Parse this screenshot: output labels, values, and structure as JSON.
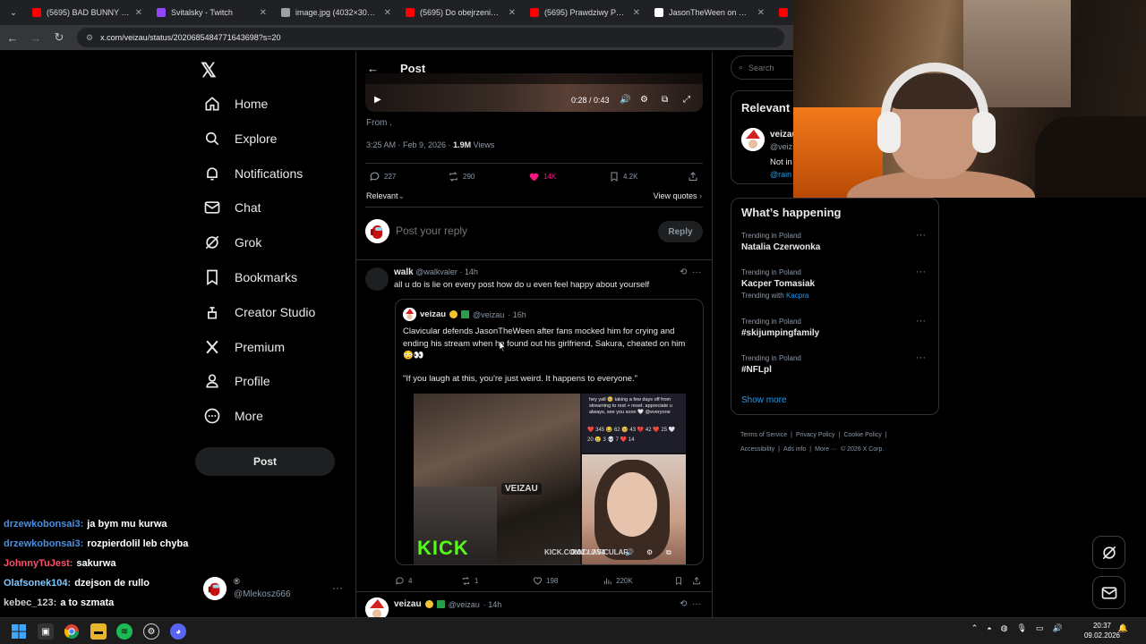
{
  "browser": {
    "tabs": [
      {
        "title": "(5695) BAD BUNNY x DRA",
        "color": "#ff0000"
      },
      {
        "title": "Svitalsky - Twitch",
        "color": "#9146ff"
      },
      {
        "title": "image.jpg (4032×3024)",
        "color": "#9aa0a6"
      },
      {
        "title": "(5695) Do obejrzenia - Yo",
        "color": "#ff0000"
      },
      {
        "title": "(5695) Prawdziwy Powód",
        "color": "#ff0000"
      },
      {
        "title": "JasonTheWeen on X: \"http",
        "color": "#ffffff"
      },
      {
        "title": "(5",
        "color": "#ff0000"
      }
    ],
    "url": "x.com/veizau/status/2020685484771643698?s=20"
  },
  "nav": {
    "items": [
      {
        "label": "Home",
        "icon": "home-icon"
      },
      {
        "label": "Explore",
        "icon": "search-icon"
      },
      {
        "label": "Notifications",
        "icon": "bell-icon"
      },
      {
        "label": "Chat",
        "icon": "mail-icon"
      },
      {
        "label": "Grok",
        "icon": "grok-icon"
      },
      {
        "label": "Bookmarks",
        "icon": "bookmark-icon"
      },
      {
        "label": "Creator Studio",
        "icon": "creator-icon"
      },
      {
        "label": "Premium",
        "icon": "x-logo-icon"
      },
      {
        "label": "Profile",
        "icon": "person-icon"
      },
      {
        "label": "More",
        "icon": "more-circle-icon"
      }
    ],
    "post_button": "Post"
  },
  "main": {
    "header_title": "Post",
    "video_time": "0:28 / 0:43",
    "from_text": "From .",
    "timestamp": "3:25 AM · Feb 9, 2026 · ",
    "views_count": "1.9M",
    "views_label": " Views",
    "actions": {
      "replies": "227",
      "reposts": "290",
      "likes": "14K",
      "bookmarks": "4.2K"
    },
    "sort_label": "Relevant",
    "view_quotes": "View quotes",
    "reply_placeholder": "Post your reply",
    "reply_button": "Reply"
  },
  "reply_tweet": {
    "name": "walk",
    "handle": "@walkvaler",
    "time": "· 14h",
    "text": "all u do is lie on every post how do u even feel happy about yourself",
    "quote": {
      "name": "veizau",
      "handle": "@veizau",
      "time": "· 16h",
      "text": "Clavicular defends JasonTheWeen after fans mocked him for crying and ending his stream when he found out his girlfriend, Sakura, cheated on him 😳👀",
      "quote_text": "\"If you laugh at this, you're just weird. It happens to everyone.\"",
      "media_tag": "VEIZAU",
      "media_brand": "KICK",
      "media_url": "KICK.COM/CLAVICULAR",
      "media_time": "0:02 / 0:54",
      "screen_text": "hey yall 🥺 taking a few days off from streaming to rest + reset. appreciate u always, see you soon 🤍 @everyone",
      "screen_stats": "❤️ 345 😂 62 🥺 43 💔 42 ❤️ 25 🤍 20 😢 3 💀 7 ❤️ 14"
    },
    "actions": {
      "replies": "4",
      "reposts": "1",
      "likes": "198",
      "views": "220K"
    }
  },
  "next_tweet": {
    "name": "veizau",
    "handle": "@veizau",
    "time": "· 14h"
  },
  "right": {
    "search_placeholder": "Search",
    "relevant_title": "Relevant",
    "relevant_name": "veizau",
    "relevant_handle": "@veiz",
    "relevant_bio": "Not in",
    "relevant_link": "@rain",
    "happening_title": "What’s happening",
    "trends": [
      {
        "context": "Trending in Poland",
        "name": "Natalia Czerwonka",
        "with": "",
        "with_link": ""
      },
      {
        "context": "Trending in Poland",
        "name": "Kacper Tomasiak",
        "with": "Trending with ",
        "with_link": "Kacpra"
      },
      {
        "context": "Trending in Poland",
        "name": "#skijumpingfamily",
        "with": "",
        "with_link": ""
      },
      {
        "context": "Trending in Poland",
        "name": "#NFLpl",
        "with": "",
        "with_link": ""
      }
    ],
    "show_more": "Show more",
    "footer": [
      "Terms of Service",
      "|",
      "Privacy Policy",
      "|",
      "Cookie Policy",
      "|",
      "Accessibility",
      "|",
      "Ads info",
      "|",
      "More ···",
      "© 2026 X Corp."
    ]
  },
  "chat": {
    "lines": [
      {
        "user": "drzewkobonsai3:",
        "msg": "ja bym mu kurwa",
        "color": "#4a90e2"
      },
      {
        "user": "drzewkobonsai3:",
        "msg": "rozpierdolil leb chyba",
        "color": "#4a90e2"
      },
      {
        "user": "JohnnyTuJest:",
        "msg": "sakurwa",
        "color": "#ff4f6d"
      },
      {
        "user": "Olafsonek104:",
        "msg": "dzejson de rullo",
        "color": "#7fc8ff"
      },
      {
        "user": "kebec_123:",
        "msg": "a to szmata",
        "color": "#cfcfcf"
      }
    ]
  },
  "account_switcher": {
    "label": "®",
    "handle": "@Mlekosz666"
  },
  "taskbar": {
    "time": "20:37",
    "date": "09.02.2026"
  },
  "colors": {
    "accent": "#1d9bf0",
    "like": "#f91880",
    "background": "#000000",
    "border": "#2f3336"
  }
}
